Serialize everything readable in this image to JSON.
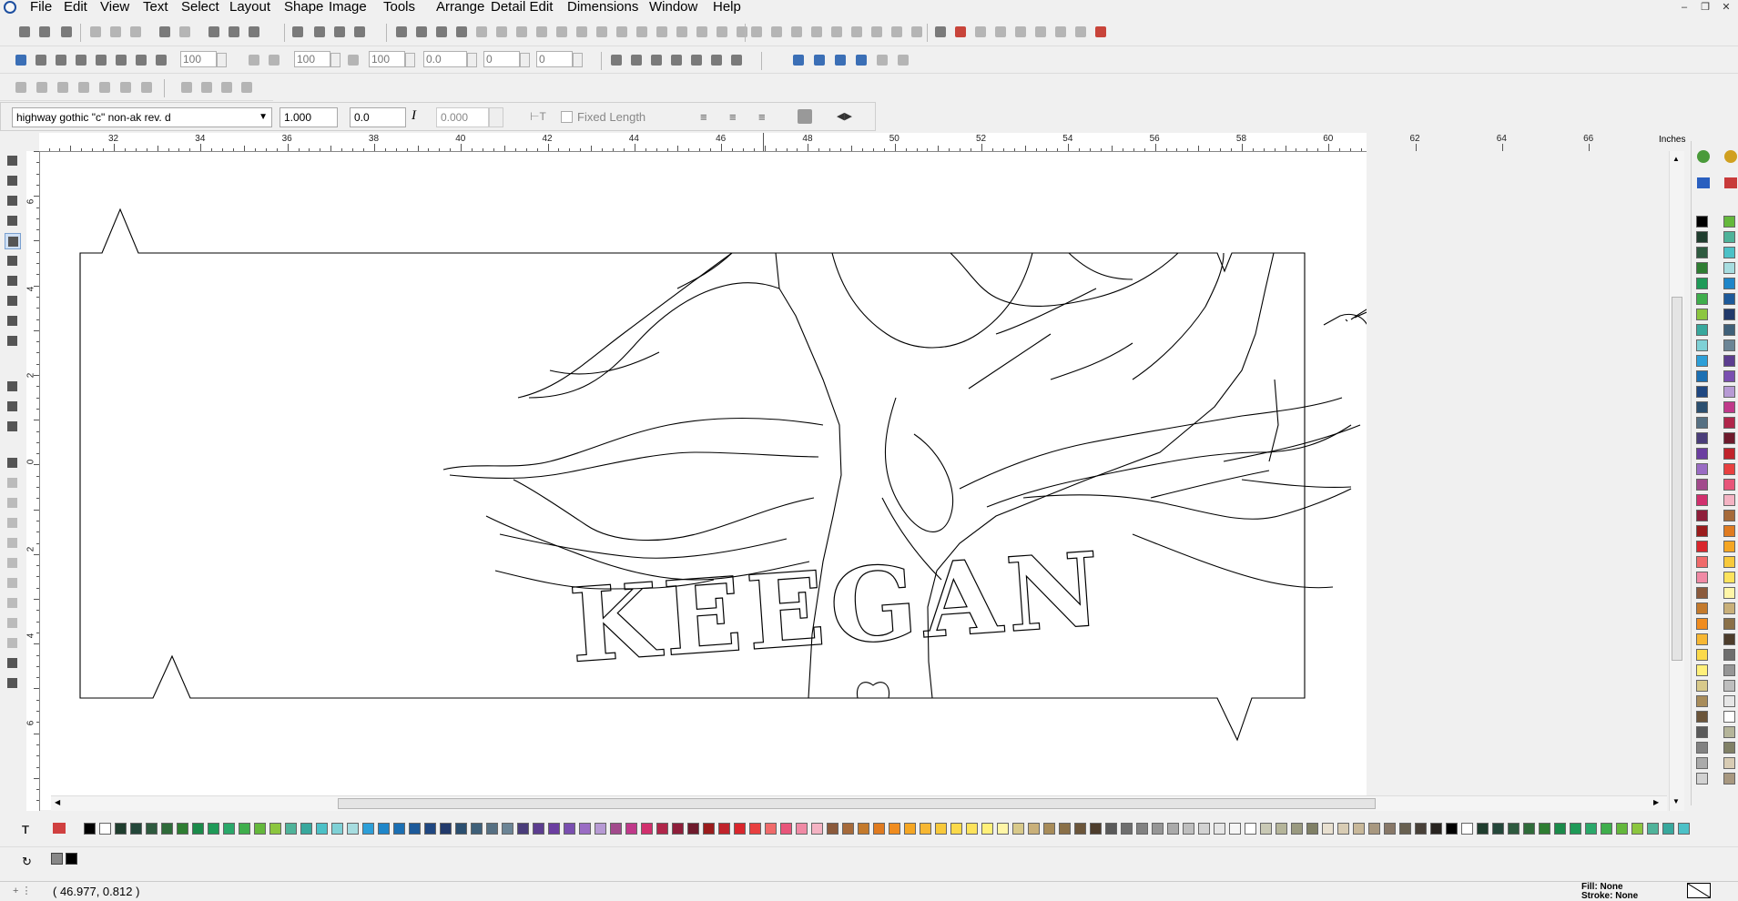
{
  "menu": [
    "File",
    "Edit",
    "View",
    "Text",
    "Select",
    "Layout",
    "Shape",
    "Image",
    "Tools",
    "Arrange",
    "Detail Edit",
    "Dimensions",
    "Window",
    "Help"
  ],
  "toolbar2": {
    "v1": "100",
    "v2": "100",
    "v3": "100",
    "v4": "0.0",
    "v5": "0",
    "v6": "0"
  },
  "text_toolbar": {
    "font": "highway gothic \"c\" non-ak rev. d",
    "size": "1.000",
    "spacing": "0.0",
    "fixed_value": "0.000",
    "fixed_length_label": "Fixed Length"
  },
  "ruler": {
    "h_labels": [
      "32",
      "34",
      "36",
      "38",
      "40",
      "42",
      "44",
      "46",
      "48",
      "50",
      "52",
      "54",
      "56",
      "58",
      "60",
      "62",
      "64",
      "66"
    ],
    "unit": "Inches",
    "v_labels": [
      "6",
      "4",
      "2",
      "0",
      "2",
      "4",
      "6"
    ]
  },
  "artwork": {
    "name_text": "KEEGAN"
  },
  "status": {
    "coords": "( 46.977, 0.812 )",
    "fill": "Fill: None",
    "stroke": "Stroke: None"
  },
  "palette_colors": [
    "#000000",
    "#ffffff",
    "#1f3d2e",
    "#24473a",
    "#2e5a3f",
    "#2f6b3a",
    "#2e7d32",
    "#1b8a4a",
    "#1f9a58",
    "#2aa86a",
    "#3fae4c",
    "#64b83c",
    "#8cc63f",
    "#4fb39a",
    "#38a89d",
    "#4cc1c7",
    "#7fd1d6",
    "#a7dde0",
    "#2d9fd8",
    "#1f86c9",
    "#1b6fb3",
    "#1d5a9a",
    "#1f4781",
    "#223a6b",
    "#2b4f70",
    "#3f6079",
    "#567083",
    "#6c8596",
    "#4a3d7a",
    "#5c3d8f",
    "#6b3ea0",
    "#7a4fb0",
    "#9a6cc4",
    "#b79ad4",
    "#a24a8c",
    "#c0398a",
    "#d1306d",
    "#b0264a",
    "#8e1e3a",
    "#6e1a2c",
    "#9b1c1c",
    "#c0232b",
    "#d9262c",
    "#e84040",
    "#f06a6a",
    "#e8557a",
    "#f08aa5",
    "#f4b3c3",
    "#8b5a3c",
    "#a66a3a",
    "#c47a2c",
    "#e07b20",
    "#f08c1f",
    "#f5a623",
    "#f7b733",
    "#f8c93b",
    "#fbd94a",
    "#fde35c",
    "#fff07a",
    "#fff6a8",
    "#d8c98a",
    "#c9b07a",
    "#a88c5a",
    "#8a7048",
    "#6b553a",
    "#4d3d2c",
    "#5a5a5a",
    "#6e6e6e",
    "#828282",
    "#969696",
    "#aaaaaa",
    "#bebebe",
    "#d2d2d2",
    "#e6e6e6",
    "#f5f5f5",
    "#ffffff",
    "#c9c9b5",
    "#b5b59a",
    "#9a9a80",
    "#808066",
    "#e8e0d0",
    "#d8ccb4",
    "#c8b89a",
    "#a89880",
    "#887868",
    "#686050",
    "#484038",
    "#282420"
  ]
}
